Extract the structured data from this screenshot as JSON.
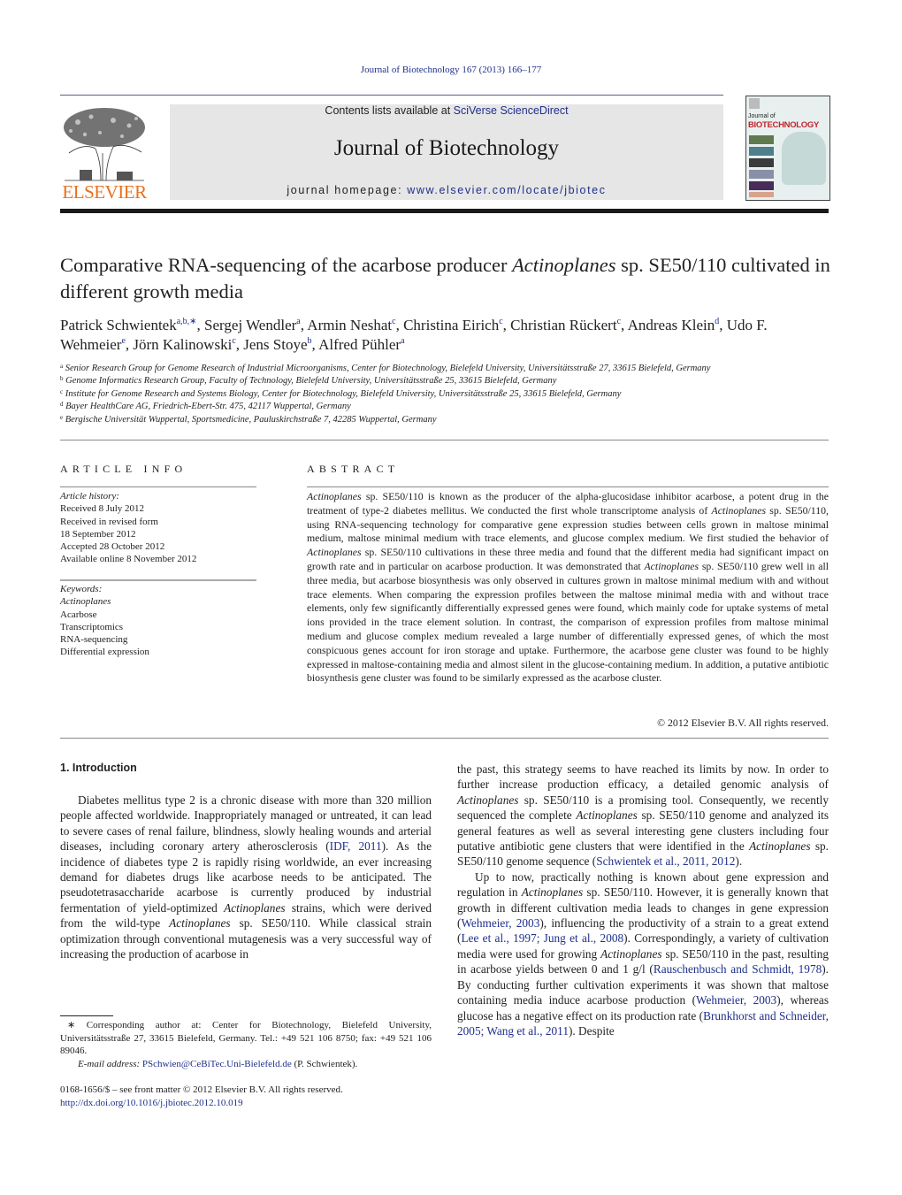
{
  "running_head": "Journal of Biotechnology 167 (2013) 166–177",
  "masthead": {
    "contents_prefix": "Contents lists available at ",
    "contents_link": "SciVerse ScienceDirect",
    "journal_name": "Journal of Biotechnology",
    "homepage_prefix": "journal homepage: ",
    "homepage_link": "www.elsevier.com/locate/jbiotec",
    "publisher_logo_text": "ELSEVIER",
    "cover_small": "Journal of",
    "cover_big": "BIOTECHNOLOGY",
    "brand_color": "#e9711c",
    "link_color": "#1f2f8c"
  },
  "article": {
    "title_part1": "Comparative RNA-sequencing of the acarbose producer ",
    "title_italic": "Actinoplanes",
    "title_part2": " sp. SE50/110 cultivated in different growth media",
    "authors": [
      {
        "name": "Patrick Schwientek",
        "sup": "a,b,∗",
        "sep": ", "
      },
      {
        "name": "Sergej Wendler",
        "sup": "a",
        "sep": ", "
      },
      {
        "name": "Armin Neshat",
        "sup": "c",
        "sep": ", "
      },
      {
        "name": "Christina Eirich",
        "sup": "c",
        "sep": ", "
      },
      {
        "name": "Christian Rückert",
        "sup": "c",
        "sep": ", "
      },
      {
        "name": "Andreas Klein",
        "sup": "d",
        "sep": ", "
      },
      {
        "name": "Udo F. Wehmeier",
        "sup": "e",
        "sep": ", "
      },
      {
        "name": "Jörn Kalinowski",
        "sup": "c",
        "sep": ", "
      },
      {
        "name": "Jens Stoye",
        "sup": "b",
        "sep": ", "
      },
      {
        "name": "Alfred Pühler",
        "sup": "a",
        "sep": ""
      }
    ],
    "affiliations": [
      {
        "key": "a",
        "text": "Senior Research Group for Genome Research of Industrial Microorganisms, Center for Biotechnology, Bielefeld University, Universitätsstraße 27, 33615 Bielefeld, Germany"
      },
      {
        "key": "b",
        "text": "Genome Informatics Research Group, Faculty of Technology, Bielefeld University, Universitätsstraße 25, 33615 Bielefeld, Germany"
      },
      {
        "key": "c",
        "text": "Institute for Genome Research and Systems Biology, Center for Biotechnology, Bielefeld University, Universitätsstraße 25, 33615 Bielefeld, Germany"
      },
      {
        "key": "d",
        "text": "Bayer HealthCare AG, Friedrich-Ebert-Str. 475, 42117 Wuppertal, Germany"
      },
      {
        "key": "e",
        "text": "Bergische Universität Wuppertal, Sportsmedicine, Pauluskirchstraße 7, 42285 Wuppertal, Germany"
      }
    ]
  },
  "article_info": {
    "label": "ARTICLE INFO",
    "history_label": "Article history:",
    "history": [
      "Received 8 July 2012",
      "Received in revised form",
      "18 September 2012",
      "Accepted 28 October 2012",
      "Available online 8 November 2012"
    ],
    "keywords_label": "Keywords:",
    "keywords": [
      {
        "text": "Actinoplanes",
        "italic": true
      },
      {
        "text": "Acarbose",
        "italic": false
      },
      {
        "text": "Transcriptomics",
        "italic": false
      },
      {
        "text": "RNA-sequencing",
        "italic": false
      },
      {
        "text": "Differential expression",
        "italic": false
      }
    ]
  },
  "abstract": {
    "label": "ABSTRACT",
    "segments": [
      {
        "t": "Actinoplanes",
        "i": true
      },
      {
        "t": " sp. SE50/110 is known as the producer of the alpha-glucosidase inhibitor acarbose, a potent drug in the treatment of type-2 diabetes mellitus. We conducted the first whole transcriptome analysis of "
      },
      {
        "t": "Actinoplanes",
        "i": true
      },
      {
        "t": " sp. SE50/110, using RNA-sequencing technology for comparative gene expression studies between cells grown in maltose minimal medium, maltose minimal medium with trace elements, and glucose complex medium. We first studied the behavior of "
      },
      {
        "t": "Actinoplanes",
        "i": true
      },
      {
        "t": " sp. SE50/110 cultivations in these three media and found that the different media had significant impact on growth rate and in particular on acarbose production. It was demonstrated that "
      },
      {
        "t": "Actinoplanes",
        "i": true
      },
      {
        "t": " sp. SE50/110 grew well in all three media, but acarbose biosynthesis was only observed in cultures grown in maltose minimal medium with and without trace elements. When comparing the expression profiles between the maltose minimal media with and without trace elements, only few significantly differentially expressed genes were found, which mainly code for uptake systems of metal ions provided in the trace element solution. In contrast, the comparison of expression profiles from maltose minimal medium and glucose complex medium revealed a large number of differentially expressed genes, of which the most conspicuous genes account for iron storage and uptake. Furthermore, the acarbose gene cluster was found to be highly expressed in maltose-containing media and almost silent in the glucose-containing medium. In addition, a putative antibiotic biosynthesis gene cluster was found to be similarly expressed as the acarbose cluster."
      }
    ],
    "copyright": "© 2012 Elsevier B.V. All rights reserved."
  },
  "introduction": {
    "heading": "1.  Introduction",
    "left_paragraphs": [
      [
        {
          "t": "Diabetes mellitus type 2 is a chronic disease with more than 320 million people affected worldwide. Inappropriately managed or untreated, it can lead to severe cases of renal failure, blindness, slowly healing wounds and arterial diseases, including coronary artery atherosclerosis ("
        },
        {
          "t": "IDF, 2011",
          "c": true
        },
        {
          "t": "). As the incidence of diabetes type 2 is rapidly rising worldwide, an ever increasing demand for diabetes drugs like acarbose needs to be anticipated. The pseudotetrasaccharide acarbose is currently produced by industrial fermentation of yield-optimized "
        },
        {
          "t": "Actinoplanes",
          "i": true
        },
        {
          "t": " strains, which were derived from the wild-type "
        },
        {
          "t": "Actinoplanes",
          "i": true
        },
        {
          "t": " sp. SE50/110. While classical strain optimization through conventional mutagenesis was a very successful way of increasing the production of acarbose in"
        }
      ]
    ],
    "right_paragraphs": [
      [
        {
          "t": "the past, this strategy seems to have reached its limits by now. In order to further increase production efficacy, a detailed genomic analysis of "
        },
        {
          "t": "Actinoplanes",
          "i": true
        },
        {
          "t": " sp. SE50/110 is a promising tool. Consequently, we recently sequenced the complete "
        },
        {
          "t": "Actinoplanes",
          "i": true
        },
        {
          "t": " sp. SE50/110 genome and analyzed its general features as well as several interesting gene clusters including four putative antibiotic gene clusters that were identified in the "
        },
        {
          "t": "Actinoplanes",
          "i": true
        },
        {
          "t": " sp. SE50/110 genome sequence ("
        },
        {
          "t": "Schwientek et al., 2011, 2012",
          "c": true
        },
        {
          "t": ")."
        }
      ],
      [
        {
          "t": "Up to now, practically nothing is known about gene expression and regulation in "
        },
        {
          "t": "Actinoplanes",
          "i": true
        },
        {
          "t": " sp. SE50/110. However, it is generally known that growth in different cultivation media leads to changes in gene expression ("
        },
        {
          "t": "Wehmeier, 2003",
          "c": true
        },
        {
          "t": "), influencing the productivity of a strain to a great extend ("
        },
        {
          "t": "Lee et al., 1997; Jung et al., 2008",
          "c": true
        },
        {
          "t": "). Correspondingly, a variety of cultivation media were used for growing "
        },
        {
          "t": "Actinoplanes",
          "i": true
        },
        {
          "t": " sp. SE50/110 in the past, resulting in acarbose yields between 0 and 1 g/l ("
        },
        {
          "t": "Rauschenbusch and Schmidt, 1978",
          "c": true
        },
        {
          "t": "). By conducting further cultivation experiments it was shown that maltose containing media induce acarbose production ("
        },
        {
          "t": "Wehmeier, 2003",
          "c": true
        },
        {
          "t": "), whereas glucose has a negative effect on its production rate ("
        },
        {
          "t": "Brunkhorst and Schneider, 2005; Wang et al., 2011",
          "c": true
        },
        {
          "t": "). Despite"
        }
      ]
    ]
  },
  "footnote": {
    "corresponding": "∗  Corresponding author at: Center for Biotechnology, Bielefeld University, Universitätsstraße 27, 33615 Bielefeld, Germany. Tel.: +49 521 106 8750; fax: +49 521 106 89046.",
    "email_label": "E-mail address: ",
    "email": "PSchwien@CeBiTec.Uni-Bielefeld.de",
    "email_suffix": " (P. Schwientek).",
    "issn": "0168-1656/$ – see front matter © 2012 Elsevier B.V. All rights reserved.",
    "doi": "http://dx.doi.org/10.1016/j.jbiotec.2012.10.019"
  }
}
